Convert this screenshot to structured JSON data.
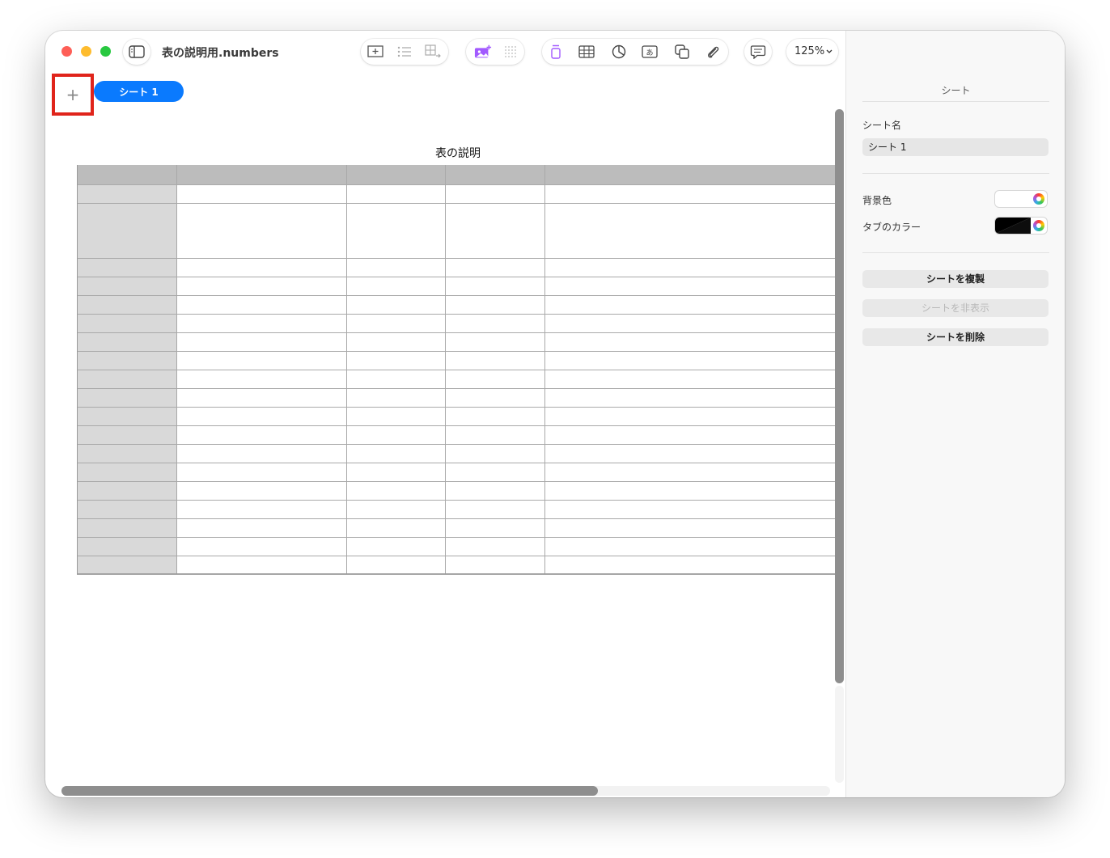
{
  "window": {
    "title": "表の説明用.numbers",
    "zoom": "125%"
  },
  "toolbar": {
    "icons": [
      "sidebar-toggle-icon",
      "insert-icon",
      "list-icon",
      "table-add-icon",
      "media-icon",
      "grid-icon",
      "text-icon",
      "table-icon",
      "chart-icon",
      "textbox-icon",
      "shape-icon",
      "attach-icon",
      "comment-icon",
      "share-icon",
      "format-icon",
      "organize-icon"
    ],
    "accent_color": "#a259ff"
  },
  "sheets": {
    "add_label": "+",
    "tabs": [
      {
        "label": "シート 1",
        "active": true
      }
    ],
    "active_color": "#0a7afe",
    "highlight_color": "#e0241b"
  },
  "table": {
    "title": "表の説明",
    "columns": 5,
    "rows": 21,
    "header_color": "#bcbcbc",
    "row_header_color": "#d9d9d9"
  },
  "sidebar": {
    "section_title": "シート",
    "sheet_name_label": "シート名",
    "sheet_name_value": "シート 1",
    "background_label": "背景色",
    "tab_color_label": "タブのカラー",
    "duplicate_label": "シートを複製",
    "hide_label": "シートを非表示",
    "delete_label": "シートを削除"
  }
}
